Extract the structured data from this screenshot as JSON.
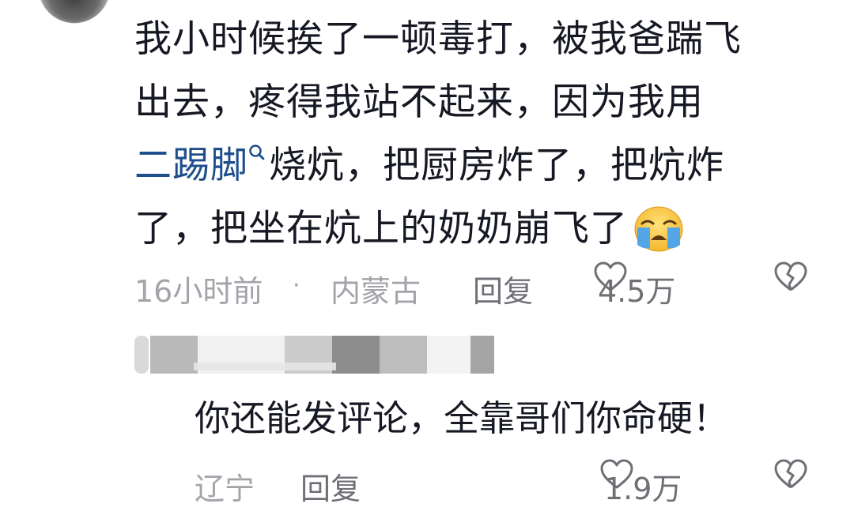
{
  "comment": {
    "line1": "我小时候挨了一顿毒打，被我爸踹飞",
    "line2": "出去，疼得我站不起来，因为我用",
    "link_word": "二踢脚",
    "line3_rest": "烧炕，把厨房炸了，把炕炸",
    "line4": "了，把坐在炕上的奶奶崩飞了",
    "emoji": "crying-face-emoji",
    "time": "16小时前",
    "separator": "·",
    "location": "内蒙古",
    "reply_label": "回复",
    "likes": "4.5万"
  },
  "reply": {
    "text": "你还能发评论，全靠哥们你命硬！",
    "location": "辽宁",
    "reply_label": "回复",
    "likes": "1.9万"
  },
  "colors": {
    "text": "#161823",
    "secondary": "#a2a4a9",
    "action": "#6e7076",
    "link": "#1e4f8c"
  }
}
